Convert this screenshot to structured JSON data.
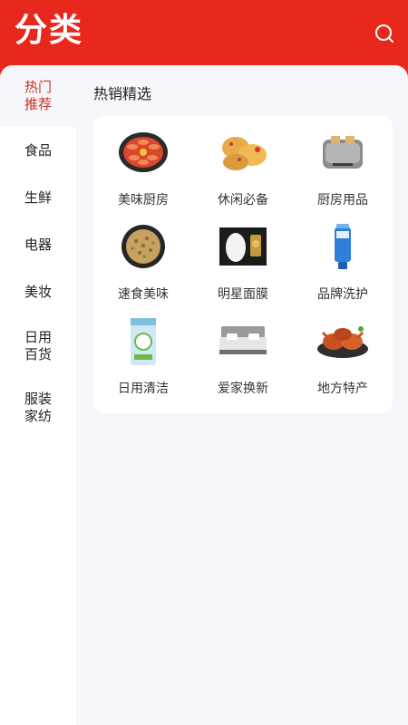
{
  "header": {
    "title": "分类",
    "search_icon": "search-icon"
  },
  "sidebar": {
    "items": [
      {
        "label": "热门推荐",
        "active": true
      },
      {
        "label": "食品"
      },
      {
        "label": "生鲜"
      },
      {
        "label": "电器"
      },
      {
        "label": "美妆"
      },
      {
        "label": "日用百货"
      },
      {
        "label": "服装家纺"
      }
    ]
  },
  "main": {
    "section_title": "热销精选",
    "categories": [
      {
        "label": "美味厨房",
        "icon": "shrimp-platter-image"
      },
      {
        "label": "休闲必备",
        "icon": "pastry-image"
      },
      {
        "label": "厨房用品",
        "icon": "toaster-image"
      },
      {
        "label": "速食美味",
        "icon": "fried-rice-pan-image"
      },
      {
        "label": "明星面膜",
        "icon": "face-mask-image"
      },
      {
        "label": "品牌洗护",
        "icon": "cleanser-tube-image"
      },
      {
        "label": "日用清洁",
        "icon": "laundry-detergent-image"
      },
      {
        "label": "爱家换新",
        "icon": "bed-image"
      },
      {
        "label": "地方特产",
        "icon": "crab-dish-image"
      }
    ]
  },
  "colors": {
    "brand_red": "#e8281c",
    "active_text": "#c5321f",
    "panel_bg": "#f7f6fa"
  }
}
